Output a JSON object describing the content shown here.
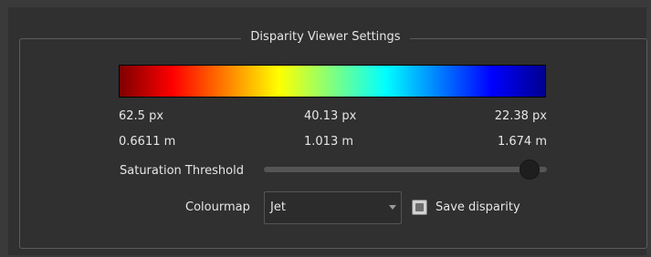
{
  "settings": {
    "title": "Disparity Viewer Settings",
    "colorbar": {
      "stops": [
        "#7f0000",
        "#ff0000",
        "#ff7f00",
        "#ffff00",
        "#7fff7f",
        "#00ffff",
        "#007fff",
        "#0000ff",
        "#00008f"
      ]
    },
    "disparity_labels": {
      "left": "62.5 px",
      "center": "40.13 px",
      "right": "22.38 px"
    },
    "distance_labels": {
      "left": "0.6611 m",
      "center": "1.013 m",
      "right": "1.674 m"
    },
    "saturation": {
      "label": "Saturation Threshold",
      "value_fraction": 0.94
    },
    "colourmap": {
      "label": "Colourmap",
      "value": "Jet"
    },
    "save_disparity": {
      "label": "Save disparity",
      "checked": false
    }
  }
}
